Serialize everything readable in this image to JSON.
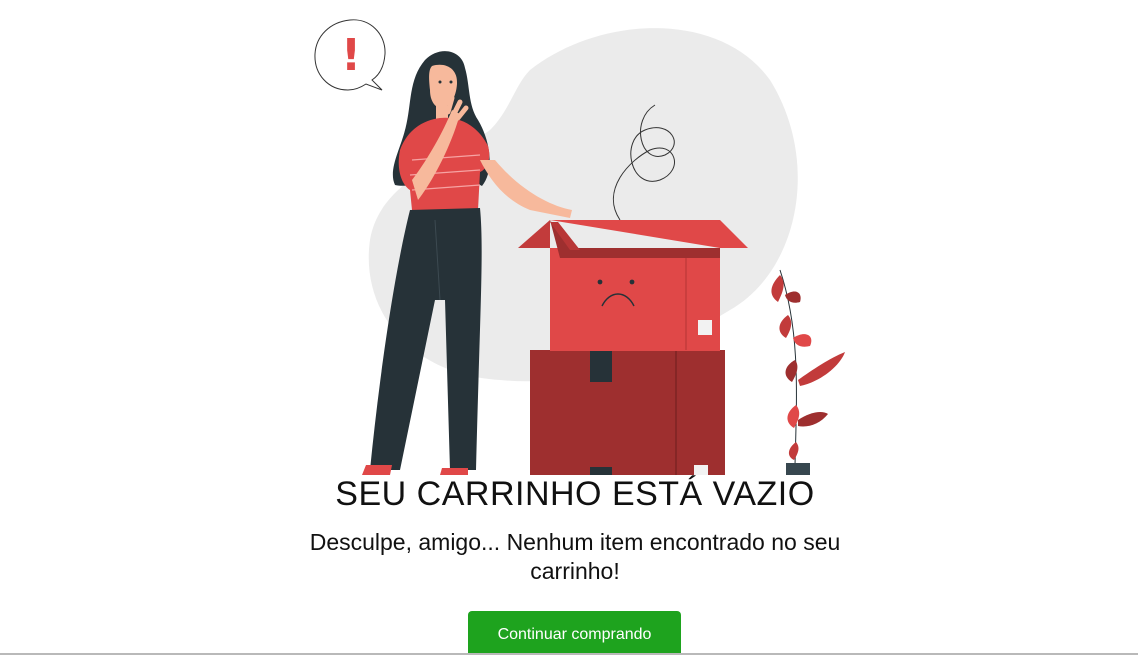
{
  "empty_cart": {
    "title": "SEU CARRINHO ESTÁ VAZIO",
    "message": "Desculpe, amigo... Nenhum item encontrado no seu carrinho!",
    "continue_label": "Continuar comprando"
  },
  "illustration": {
    "alert_symbol": "!",
    "icon": "sad-empty-box-illustration"
  },
  "colors": {
    "accent_red": "#e04848",
    "dark_red": "#9e2f2f",
    "button_green": "#1ea31e",
    "blob_gray": "#ebebeb",
    "pants_dark": "#263238"
  }
}
